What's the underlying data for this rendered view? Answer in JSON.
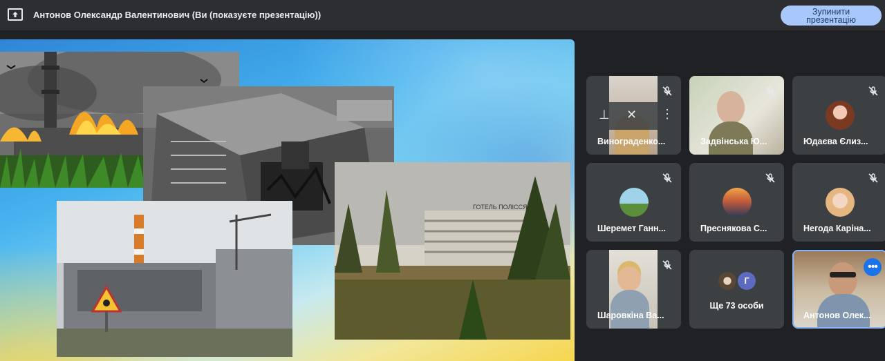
{
  "topbar": {
    "presenter_title": "Антонов Олександр Валентинович (Ви (показуєте презентацію))",
    "stop_button": "Зупинити презентацію",
    "present_icon": "present-to-all-icon"
  },
  "slide": {
    "background_colors": [
      "#2f86d8",
      "#45b2ee",
      "#f6d64e"
    ],
    "photos": [
      {
        "name": "reactor-fire-photo"
      },
      {
        "name": "reactor-ruins-aerial-photo"
      },
      {
        "name": "pripyat-hotel-photo"
      },
      {
        "name": "sarcophagus-radiation-sign-photo"
      }
    ],
    "pripyat_sign": "ГОТЕЛЬ ПОЛІССЯ"
  },
  "participants": [
    {
      "name": "Винограденко...",
      "muted": true,
      "type": "video-hover"
    },
    {
      "name": "Задвінська Ю...",
      "muted": true,
      "type": "video"
    },
    {
      "name": "Юдаєва Єлиз...",
      "muted": true,
      "type": "avatar"
    },
    {
      "name": "Шеремет Ганн...",
      "muted": true,
      "type": "avatar"
    },
    {
      "name": "Преснякова С...",
      "muted": true,
      "type": "avatar"
    },
    {
      "name": "Негода Каріна...",
      "muted": true,
      "type": "avatar"
    },
    {
      "name": "Шаровкіна Ва...",
      "muted": true,
      "type": "video"
    },
    {
      "name": "Ще 73 особи",
      "type": "overflow",
      "initial": "Г"
    },
    {
      "name": "Антонов Олек...",
      "type": "self-video",
      "active": true
    }
  ],
  "colors": {
    "accent": "#8ab4f8",
    "button_bg": "#a8c7fa",
    "tile_bg": "#3c4043",
    "app_bg": "#202124"
  }
}
